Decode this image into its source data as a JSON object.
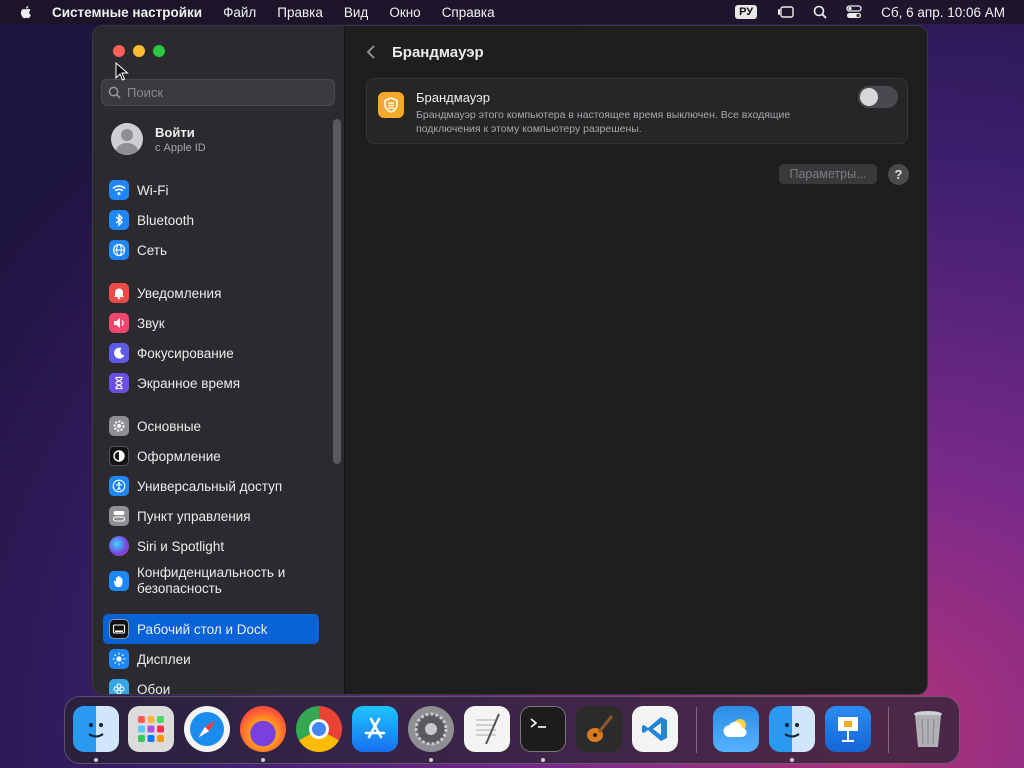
{
  "menubar": {
    "app_name": "Системные настройки",
    "items": [
      "Файл",
      "Правка",
      "Вид",
      "Окно",
      "Справка"
    ],
    "keyboard_layout": "РУ",
    "clock": "Сб, 6 апр.  10:06 AM"
  },
  "sidebar": {
    "search_placeholder": "Поиск",
    "account": {
      "name": "Войти",
      "subtitle": "с Apple ID"
    },
    "items": [
      {
        "label": "Wi-Fi",
        "icon": "wifi-icon",
        "color": "#1e86f5"
      },
      {
        "label": "Bluetooth",
        "icon": "bluetooth-icon",
        "color": "#1e86f5"
      },
      {
        "label": "Сеть",
        "icon": "globe-icon",
        "color": "#1e86f5"
      },
      {
        "label": "Уведомления",
        "icon": "bell-icon",
        "color": "#ee4b47"
      },
      {
        "label": "Звук",
        "icon": "speaker-icon",
        "color": "#ee4770"
      },
      {
        "label": "Фокусирование",
        "icon": "moon-icon",
        "color": "#5e5ce6"
      },
      {
        "label": "Экранное время",
        "icon": "hourglass-icon",
        "color": "#6b4ee6"
      },
      {
        "label": "Основные",
        "icon": "gear-icon",
        "color": "#8e8e93"
      },
      {
        "label": "Оформление",
        "icon": "appearance-icon",
        "color": "#111111"
      },
      {
        "label": "Универсальный доступ",
        "icon": "accessibility-icon",
        "color": "#1e86f5"
      },
      {
        "label": "Пункт управления",
        "icon": "control-center-icon",
        "color": "#8e8e93"
      },
      {
        "label": "Siri и Spotlight",
        "icon": "siri-icon",
        "color": "#7a3fe0"
      },
      {
        "label": "Конфиденциальность и безопасность",
        "icon": "hand-icon",
        "color": "#1e86f5"
      },
      {
        "label": "Рабочий стол и Dock",
        "icon": "dock-icon",
        "color": "#111111"
      },
      {
        "label": "Дисплеи",
        "icon": "sun-icon",
        "color": "#1e86f5"
      },
      {
        "label": "Обои",
        "icon": "flower-icon",
        "color": "#34a6e8"
      }
    ],
    "selected_item": "Рабочий стол и Dock"
  },
  "main": {
    "title": "Брандмауэр",
    "firewall": {
      "title": "Брандмауэр",
      "description": "Брандмауэр этого компьютера в настоящее время выключен. Все входящие подключения к этому компьютеру разрешены.",
      "enabled": false
    },
    "params_button": "Параметры...",
    "help_button": "?"
  },
  "dock": {
    "apps": [
      "finder-icon",
      "launchpad-icon",
      "safari-icon",
      "firefox-icon",
      "chrome-icon",
      "app-store-icon",
      "system-settings-icon",
      "textedit-icon",
      "terminal-icon",
      "garageband-icon",
      "vscode-icon",
      "weather-icon",
      "preview-icon",
      "keynote-icon",
      "trash-icon"
    ]
  }
}
